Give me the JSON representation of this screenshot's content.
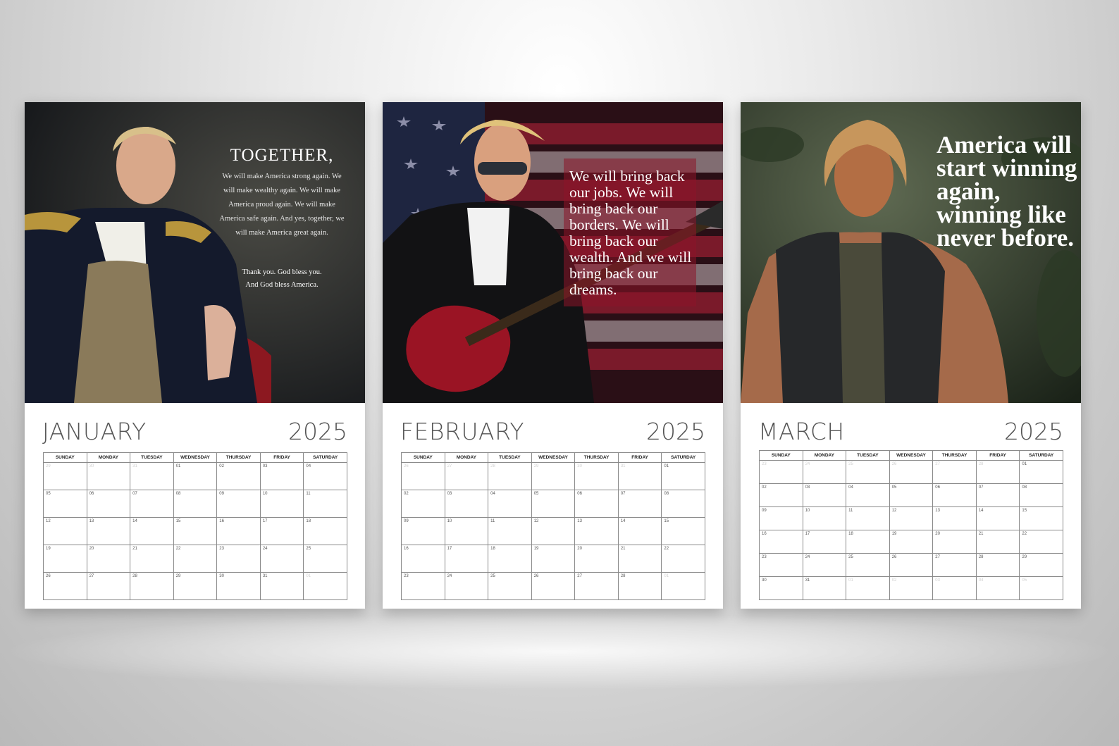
{
  "weekday_headers": [
    "SUNDAY",
    "MONDAY",
    "TUESDAY",
    "WEDNESDAY",
    "THURSDAY",
    "FRIDAY",
    "SATURDAY"
  ],
  "pages": [
    {
      "month": "JANUARY",
      "year": "2025",
      "quote": {
        "heading": "TOGETHER,",
        "body": "We will make America strong again. We will make wealthy again. We will make America proud again. We will make America safe again. And yes, together, we will make America great again.",
        "closing_line1": "Thank you. God bless you.",
        "closing_line2": "And God bless America."
      },
      "weeks": [
        [
          {
            "d": "29",
            "m": true
          },
          {
            "d": "30",
            "m": true
          },
          {
            "d": "31",
            "m": true
          },
          {
            "d": "01"
          },
          {
            "d": "02"
          },
          {
            "d": "03"
          },
          {
            "d": "04"
          }
        ],
        [
          {
            "d": "05"
          },
          {
            "d": "06"
          },
          {
            "d": "07"
          },
          {
            "d": "08"
          },
          {
            "d": "09"
          },
          {
            "d": "10"
          },
          {
            "d": "11"
          }
        ],
        [
          {
            "d": "12"
          },
          {
            "d": "13"
          },
          {
            "d": "14"
          },
          {
            "d": "15"
          },
          {
            "d": "16"
          },
          {
            "d": "17"
          },
          {
            "d": "18"
          }
        ],
        [
          {
            "d": "19"
          },
          {
            "d": "20"
          },
          {
            "d": "21"
          },
          {
            "d": "22"
          },
          {
            "d": "23"
          },
          {
            "d": "24"
          },
          {
            "d": "25"
          }
        ],
        [
          {
            "d": "26"
          },
          {
            "d": "27"
          },
          {
            "d": "28"
          },
          {
            "d": "29"
          },
          {
            "d": "30"
          },
          {
            "d": "31"
          },
          {
            "d": "01",
            "m": true
          }
        ]
      ]
    },
    {
      "month": "FEBRUARY",
      "year": "2025",
      "quote": {
        "text": "We will bring back our jobs. We will bring back our borders. We will bring back our wealth. And we will bring back our dreams."
      },
      "weeks": [
        [
          {
            "d": "26",
            "m": true
          },
          {
            "d": "27",
            "m": true
          },
          {
            "d": "28",
            "m": true
          },
          {
            "d": "29",
            "m": true
          },
          {
            "d": "30",
            "m": true
          },
          {
            "d": "31",
            "m": true
          },
          {
            "d": "01"
          }
        ],
        [
          {
            "d": "02"
          },
          {
            "d": "03"
          },
          {
            "d": "04"
          },
          {
            "d": "05"
          },
          {
            "d": "06"
          },
          {
            "d": "07"
          },
          {
            "d": "08"
          }
        ],
        [
          {
            "d": "09"
          },
          {
            "d": "10"
          },
          {
            "d": "11"
          },
          {
            "d": "12"
          },
          {
            "d": "13"
          },
          {
            "d": "14"
          },
          {
            "d": "15"
          }
        ],
        [
          {
            "d": "16"
          },
          {
            "d": "17"
          },
          {
            "d": "18"
          },
          {
            "d": "19"
          },
          {
            "d": "20"
          },
          {
            "d": "21"
          },
          {
            "d": "22"
          }
        ],
        [
          {
            "d": "23"
          },
          {
            "d": "24"
          },
          {
            "d": "25"
          },
          {
            "d": "26"
          },
          {
            "d": "27"
          },
          {
            "d": "28"
          },
          {
            "d": "01",
            "m": true
          }
        ]
      ]
    },
    {
      "month": "MARCH",
      "year": "2025",
      "quote": {
        "text": "America will start winning again, winning like never before."
      },
      "weeks": [
        [
          {
            "d": "23",
            "m": true
          },
          {
            "d": "24",
            "m": true
          },
          {
            "d": "25",
            "m": true
          },
          {
            "d": "26",
            "m": true
          },
          {
            "d": "27",
            "m": true
          },
          {
            "d": "28",
            "m": true
          },
          {
            "d": "01"
          }
        ],
        [
          {
            "d": "02"
          },
          {
            "d": "03"
          },
          {
            "d": "04"
          },
          {
            "d": "05"
          },
          {
            "d": "06"
          },
          {
            "d": "07"
          },
          {
            "d": "08"
          }
        ],
        [
          {
            "d": "09"
          },
          {
            "d": "10"
          },
          {
            "d": "11"
          },
          {
            "d": "12"
          },
          {
            "d": "13"
          },
          {
            "d": "14"
          },
          {
            "d": "15"
          }
        ],
        [
          {
            "d": "16"
          },
          {
            "d": "17"
          },
          {
            "d": "18"
          },
          {
            "d": "19"
          },
          {
            "d": "20"
          },
          {
            "d": "21"
          },
          {
            "d": "22"
          }
        ],
        [
          {
            "d": "23"
          },
          {
            "d": "24"
          },
          {
            "d": "25"
          },
          {
            "d": "26"
          },
          {
            "d": "27"
          },
          {
            "d": "28"
          },
          {
            "d": "29"
          }
        ],
        [
          {
            "d": "30"
          },
          {
            "d": "31"
          },
          {
            "d": "01",
            "m": true
          },
          {
            "d": "02",
            "m": true
          },
          {
            "d": "03",
            "m": true
          },
          {
            "d": "04",
            "m": true
          },
          {
            "d": "05",
            "m": true
          }
        ]
      ]
    }
  ]
}
